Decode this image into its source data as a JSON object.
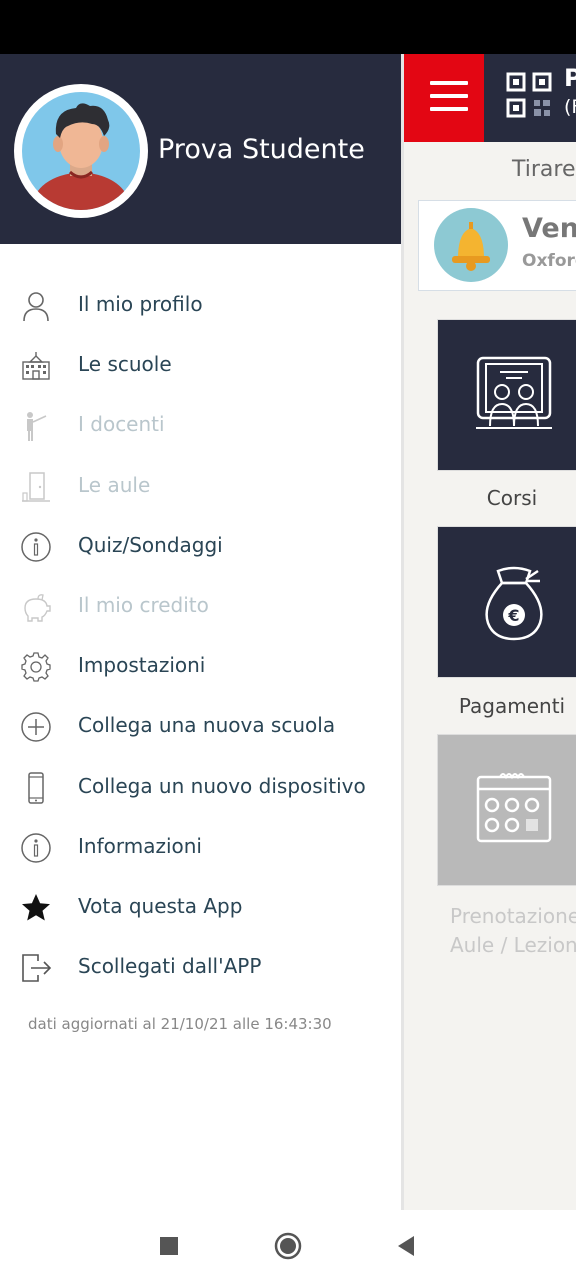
{
  "drawer": {
    "user_name": "Prova Studente",
    "menu": [
      {
        "label": "Il mio profilo",
        "icon": "user-icon",
        "enabled": true
      },
      {
        "label": "Le scuole",
        "icon": "school-building-icon",
        "enabled": true
      },
      {
        "label": "I docenti",
        "icon": "teacher-icon",
        "enabled": false
      },
      {
        "label": "Le aule",
        "icon": "classroom-door-icon",
        "enabled": false
      },
      {
        "label": "Quiz/Sondaggi",
        "icon": "info-circle-icon",
        "enabled": true
      },
      {
        "label": "Il mio credito",
        "icon": "piggy-bank-icon",
        "enabled": false
      },
      {
        "label": "Impostazioni",
        "icon": "gear-icon",
        "enabled": true
      },
      {
        "label": "Collega una nuova scuola",
        "icon": "plus-circle-icon",
        "enabled": true
      },
      {
        "label": "Collega un nuovo dispositivo",
        "icon": "smartphone-icon",
        "enabled": true
      },
      {
        "label": "Informazioni",
        "icon": "info-circle-icon",
        "enabled": true
      },
      {
        "label": "Vota questa App",
        "icon": "star-icon",
        "enabled": true
      },
      {
        "label": "Scollegati dall'APP",
        "icon": "logout-icon",
        "enabled": true
      }
    ],
    "updated_text": "dati aggiornati al 21/10/21 alle 16:43:30"
  },
  "background": {
    "header_title": "P",
    "header_subtitle": "(F",
    "pull_text": "Tirare",
    "notice_title": "Vene",
    "notice_subtitle": "Oxford",
    "tiles": [
      {
        "label": "Corsi",
        "icon": "classroom-board-icon",
        "enabled": true
      },
      {
        "label": "Pagamenti",
        "icon": "money-bag-euro-icon",
        "enabled": true
      },
      {
        "label_line1": "Prenotazione",
        "label_line2": "Aule / Lezioni",
        "icon": "calendar-icon",
        "enabled": false
      }
    ]
  },
  "colors": {
    "header_bg": "#272b3e",
    "accent_red": "#e30613",
    "menu_text": "#2a4555",
    "menu_text_disabled": "#b9c6cc"
  },
  "navbar": {
    "icons": [
      "recent-apps-icon",
      "home-icon",
      "back-icon"
    ]
  }
}
